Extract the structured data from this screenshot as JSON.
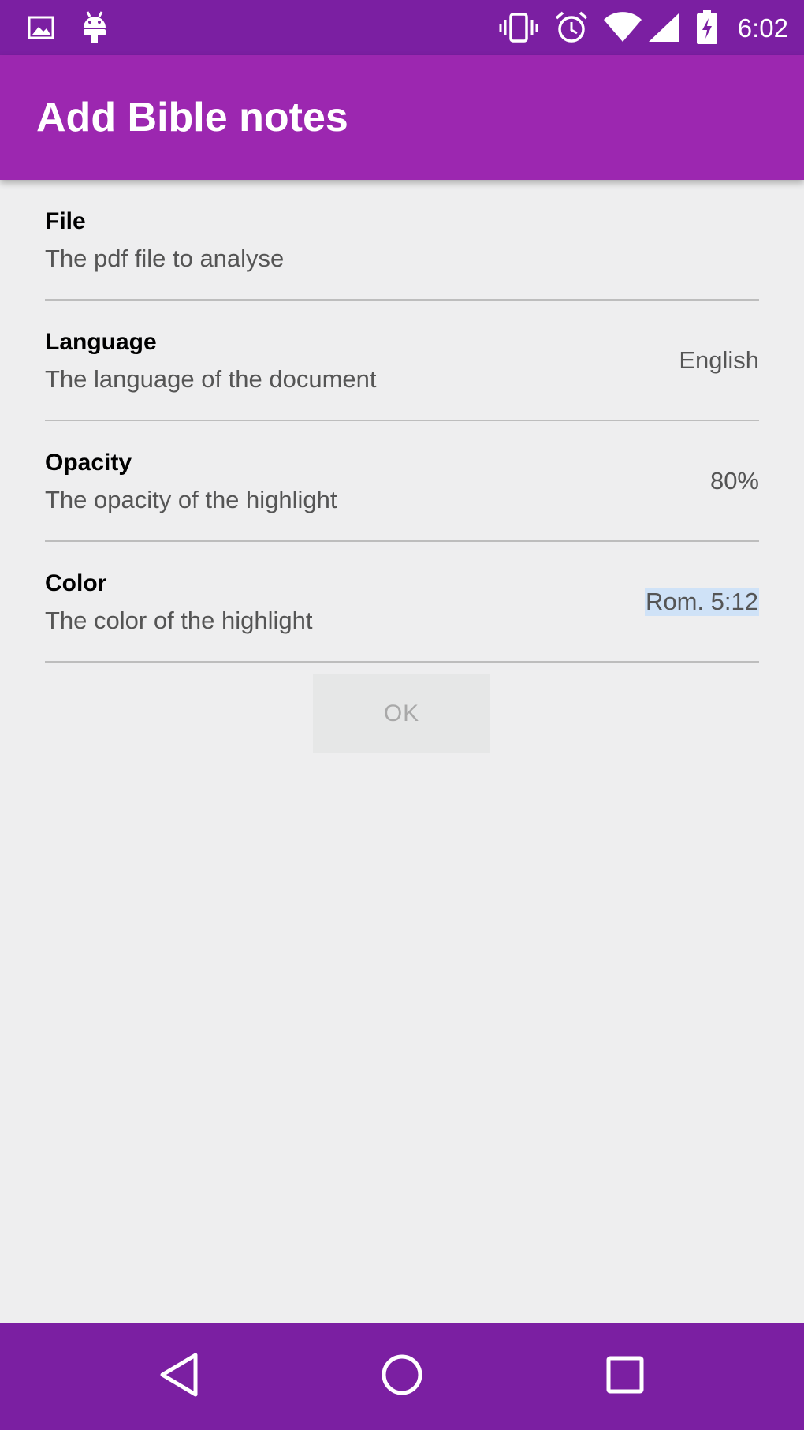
{
  "status_bar": {
    "time": "6:02",
    "left_icons": [
      "image-icon",
      "android-icon"
    ],
    "right_icons": [
      "vibrate-icon",
      "alarm-icon",
      "wifi-icon",
      "signal-icon",
      "battery-charging-icon"
    ],
    "color": "#7b1fa2"
  },
  "app_bar": {
    "title": "Add Bible notes",
    "color": "#9c27b0"
  },
  "preferences": [
    {
      "title": "File",
      "summary": "The pdf file to analyse",
      "value": ""
    },
    {
      "title": "Language",
      "summary": "The language of the document",
      "value": "English"
    },
    {
      "title": "Opacity",
      "summary": "The opacity of the highlight",
      "value": "80%"
    },
    {
      "title": "Color",
      "summary": "The color of the highlight",
      "value": "Rom. 5:12"
    }
  ],
  "ok_button": {
    "label": "OK",
    "enabled": false
  },
  "nav_bar": {
    "icons": [
      "back-icon",
      "home-icon",
      "recents-icon"
    ],
    "color": "#7b1fa2"
  }
}
